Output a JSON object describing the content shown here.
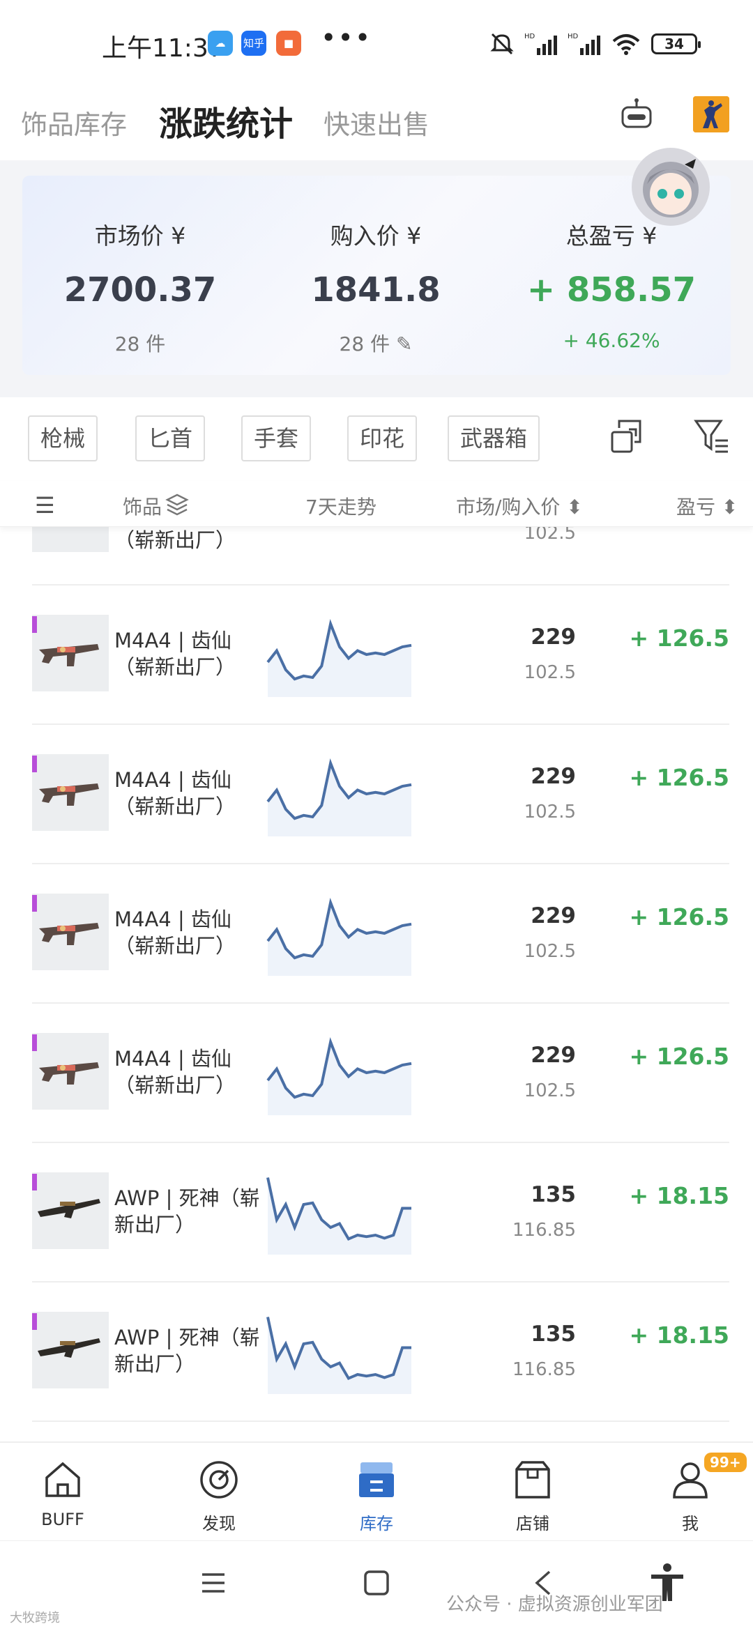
{
  "status": {
    "time": "上午11:37",
    "app_icons": [
      {
        "name": "cloud-app-icon",
        "color": "#3aa0f0",
        "label": ""
      },
      {
        "name": "zhihu-app-icon",
        "color": "#1e6ff2",
        "label": "知乎"
      },
      {
        "name": "video-app-icon",
        "color": "#f26b3a",
        "label": ""
      }
    ],
    "more": "•••",
    "battery": "34"
  },
  "tabs": [
    {
      "label": "饰品库存",
      "active": false
    },
    {
      "label": "涨跌统计",
      "active": true
    },
    {
      "label": "快速出售",
      "active": false
    }
  ],
  "summary": {
    "market": {
      "label": "市场价 ¥",
      "value": "2700.37",
      "sub": "28 件"
    },
    "purchase": {
      "label": "购入价 ¥",
      "value": "1841.8",
      "sub": "28 件 ✎"
    },
    "profit": {
      "label": "总盈亏 ¥",
      "value": "+ 858.57",
      "sub": "+ 46.62%"
    }
  },
  "filters": [
    "枪械",
    "匕首",
    "手套",
    "印花",
    "武器箱"
  ],
  "columns": {
    "menu": "☰",
    "item": "饰品",
    "trend": "7天走势",
    "price": "市场/购入价 ⬍",
    "profit": "盈亏 ⬍"
  },
  "partial_row": {
    "name": "（崭新出厂）",
    "buy": "102.5"
  },
  "items": [
    {
      "name_line1": "M4A4 | 齿仙",
      "name_line2": "（崭新出厂）",
      "price": "229",
      "buy": "102.5",
      "profit": "+ 126.5",
      "trend": [
        60,
        45,
        70,
        82,
        78,
        80,
        65,
        10,
        40,
        55,
        45,
        50,
        48,
        50,
        45,
        40,
        38
      ]
    },
    {
      "name_line1": "M4A4 | 齿仙",
      "name_line2": "（崭新出厂）",
      "price": "229",
      "buy": "102.5",
      "profit": "+ 126.5",
      "trend": [
        60,
        45,
        70,
        82,
        78,
        80,
        65,
        10,
        40,
        55,
        45,
        50,
        48,
        50,
        45,
        40,
        38
      ]
    },
    {
      "name_line1": "M4A4 | 齿仙",
      "name_line2": "（崭新出厂）",
      "price": "229",
      "buy": "102.5",
      "profit": "+ 126.5",
      "trend": [
        60,
        45,
        70,
        82,
        78,
        80,
        65,
        10,
        40,
        55,
        45,
        50,
        48,
        50,
        45,
        40,
        38
      ]
    },
    {
      "name_line1": "M4A4 | 齿仙",
      "name_line2": "（崭新出厂）",
      "price": "229",
      "buy": "102.5",
      "profit": "+ 126.5",
      "trend": [
        60,
        45,
        70,
        82,
        78,
        80,
        65,
        10,
        40,
        55,
        45,
        50,
        48,
        50,
        45,
        40,
        38
      ]
    },
    {
      "name_line1": "AWP | 死神（崭",
      "name_line2": "新出厂）",
      "price": "135",
      "buy": "116.85",
      "profit": "+ 18.15",
      "trend": [
        5,
        60,
        40,
        70,
        40,
        38,
        60,
        70,
        65,
        85,
        80,
        82,
        80,
        84,
        80,
        45,
        45
      ]
    },
    {
      "name_line1": "AWP | 死神（崭",
      "name_line2": "新出厂）",
      "price": "135",
      "buy": "116.85",
      "profit": "+ 18.15",
      "trend": [
        5,
        60,
        40,
        70,
        40,
        38,
        60,
        70,
        65,
        85,
        80,
        82,
        80,
        84,
        80,
        45,
        45
      ]
    }
  ],
  "bottom_nav": [
    {
      "label": "BUFF",
      "icon": "home-icon",
      "active": false
    },
    {
      "label": "发现",
      "icon": "compass-icon",
      "active": false
    },
    {
      "label": "库存",
      "icon": "inventory-icon",
      "active": true
    },
    {
      "label": "店铺",
      "icon": "shop-icon",
      "active": false
    },
    {
      "label": "我",
      "icon": "user-icon",
      "active": false,
      "badge": "99+"
    }
  ],
  "watermark": "公众号 · 虚拟资源创业军团",
  "watermark_small": "大牧跨境",
  "colors": {
    "profit": "#3fa858",
    "accent": "#2f6cc6",
    "rarity": "#b84ed9",
    "trend_line": "#4a6fa5"
  }
}
